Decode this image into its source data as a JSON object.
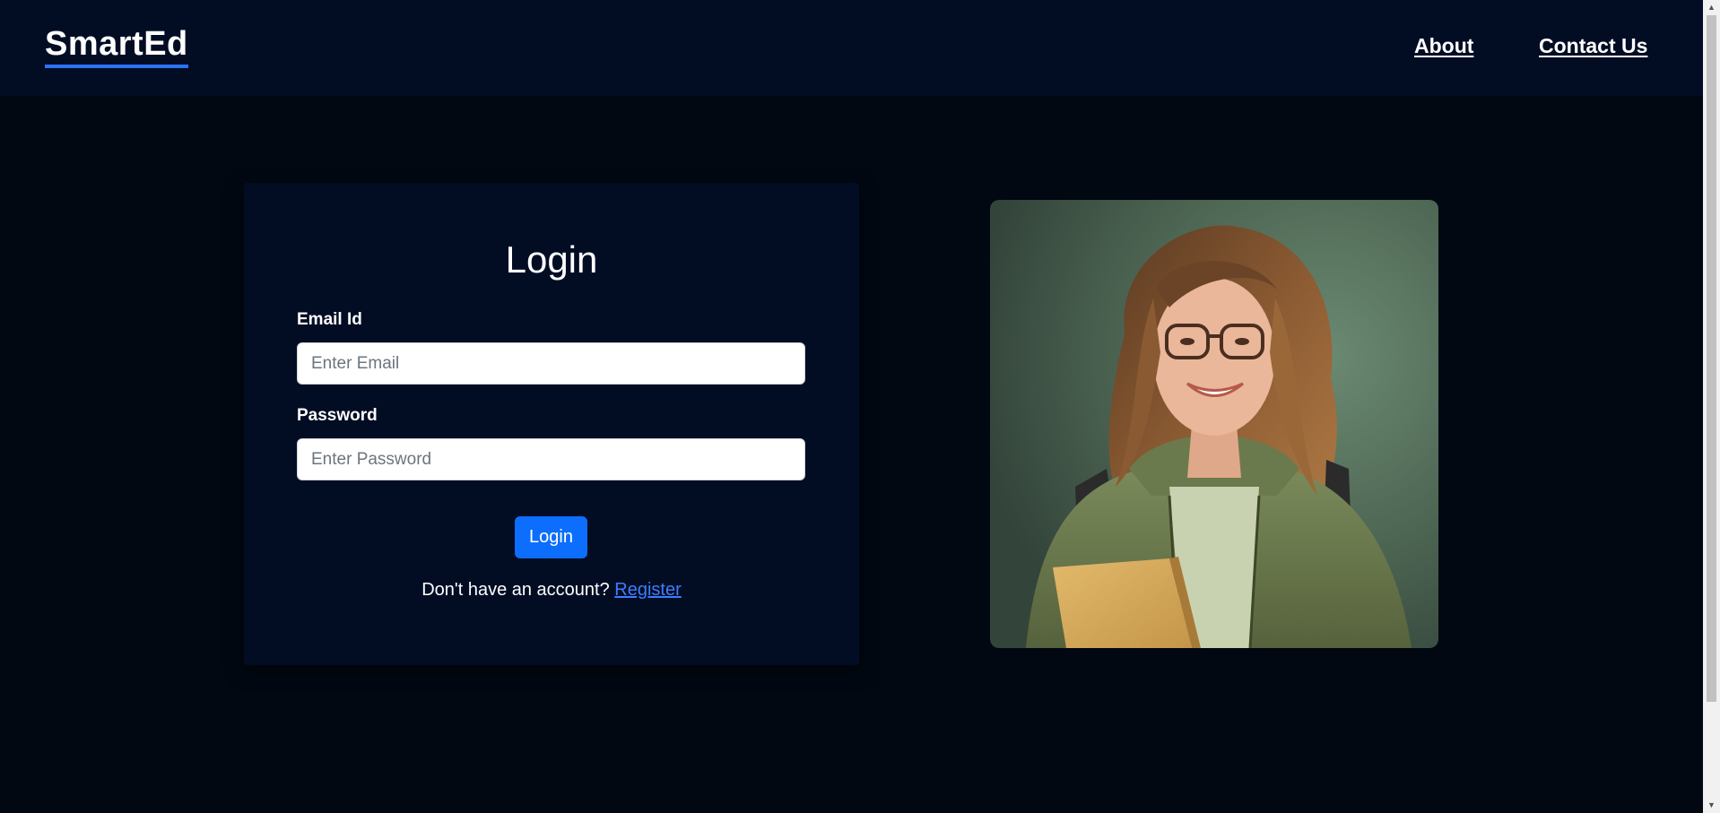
{
  "navbar": {
    "brand": "SmartEd",
    "links": [
      "About",
      "Contact Us"
    ]
  },
  "login": {
    "title": "Login",
    "email_label": "Email Id",
    "email_placeholder": "Enter Email",
    "email_value": "",
    "password_label": "Password",
    "password_placeholder": "Enter Password",
    "password_value": "",
    "submit_label": "Login",
    "register_prompt": "Don't have an account?",
    "register_link": "Register"
  },
  "colors": {
    "background": "#020812",
    "panel": "#020d24",
    "primary_button": "#0d6efd",
    "link": "#3d7dff",
    "brand_underline": "#2a73f5"
  },
  "icons": {
    "scroll_up": "scroll-up-arrow-icon",
    "scroll_down": "scroll-down-arrow-icon"
  }
}
